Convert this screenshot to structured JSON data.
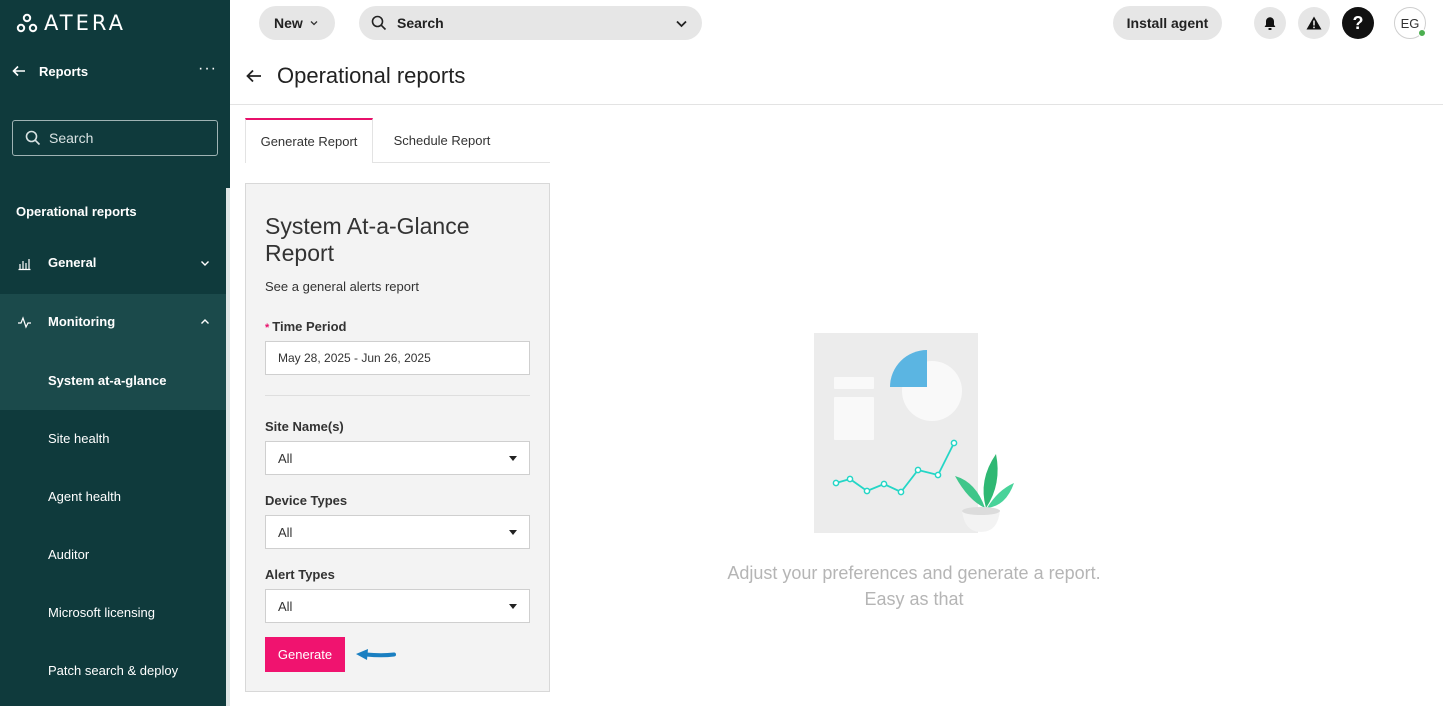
{
  "brand": {
    "name": "ATERA"
  },
  "sidebar": {
    "header_title": "Reports",
    "more_label": "···",
    "search_placeholder": "Search",
    "section_title": "Operational reports",
    "groups": [
      {
        "label": "General",
        "icon": "bar-chart-icon",
        "expanded": false
      },
      {
        "label": "Monitoring",
        "icon": "pulse-icon",
        "expanded": true
      }
    ],
    "items": [
      {
        "label": "System at-a-glance",
        "active": true
      },
      {
        "label": "Site health",
        "active": false
      },
      {
        "label": "Agent health",
        "active": false
      },
      {
        "label": "Auditor",
        "active": false
      },
      {
        "label": "Microsoft licensing",
        "active": false
      },
      {
        "label": "Patch search & deploy",
        "active": false
      }
    ]
  },
  "topbar": {
    "new_label": "New",
    "search_label": "Search",
    "install_label": "Install agent",
    "help_label": "?",
    "avatar_initials": "EG"
  },
  "page": {
    "title": "Operational reports"
  },
  "tabs": [
    {
      "label": "Generate Report",
      "active": true
    },
    {
      "label": "Schedule Report",
      "active": false
    }
  ],
  "form": {
    "title": "System At-a-Glance Report",
    "subtitle": "See a general alerts report",
    "time_period": {
      "label": "Time Period",
      "required_mark": "*",
      "value": "May 28, 2025 - Jun 26, 2025"
    },
    "site_names": {
      "label": "Site Name(s)",
      "value": "All"
    },
    "device_types": {
      "label": "Device Types",
      "value": "All"
    },
    "alert_types": {
      "label": "Alert Types",
      "value": "All"
    },
    "generate_label": "Generate"
  },
  "empty_state": {
    "line1": "Adjust your preferences and generate a report.",
    "line2": "Easy as that"
  },
  "colors": {
    "sidebar_bg": "#0f3a3c",
    "accent": "#f0136f",
    "annotation_arrow": "#1a7fc1"
  }
}
